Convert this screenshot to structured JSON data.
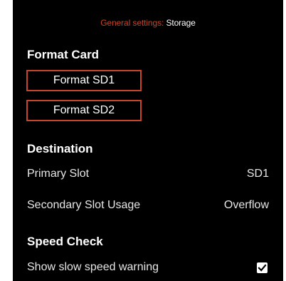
{
  "header": {
    "breadcrumb_parent": "General settings: ",
    "breadcrumb_current": "Storage"
  },
  "format_card": {
    "title": "Format Card",
    "buttons": [
      "Format SD1",
      "Format SD2"
    ]
  },
  "destination": {
    "title": "Destination",
    "rows": [
      {
        "label": "Primary Slot",
        "value": "SD1"
      },
      {
        "label": "Secondary Slot Usage",
        "value": "Overflow"
      }
    ]
  },
  "speed_check": {
    "title": "Speed Check",
    "label": "Show slow speed warning",
    "checked": true
  },
  "colors": {
    "background": "#000000",
    "accent": "#c8442a",
    "text": "#ffffff"
  }
}
